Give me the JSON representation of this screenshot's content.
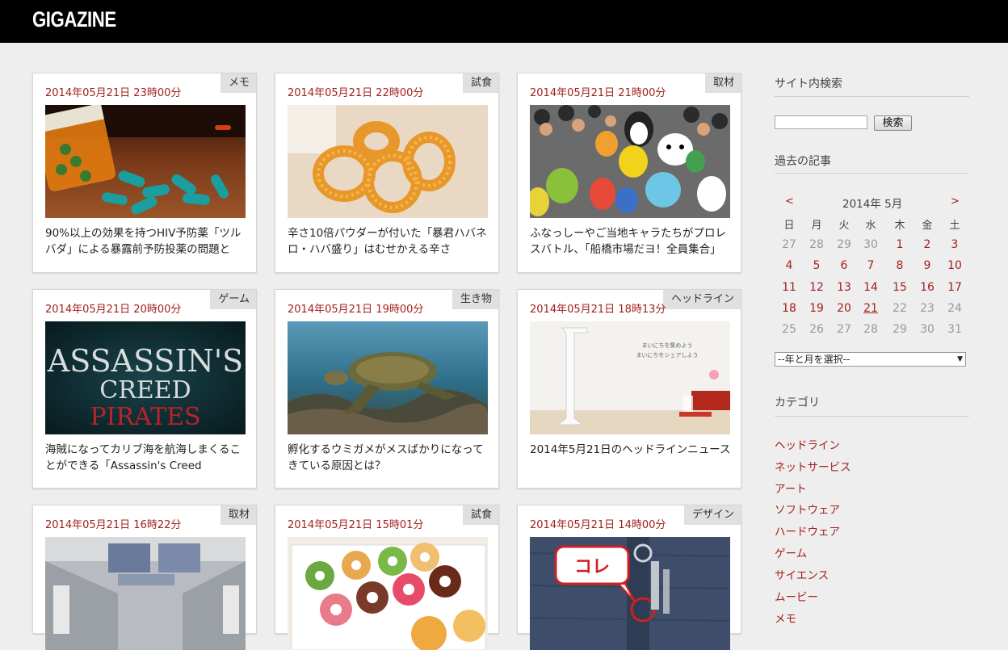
{
  "site": {
    "logo": "GIGAZINE"
  },
  "articles": [
    {
      "date": "2014年05月21日 23時00分",
      "tag": "メモ",
      "title": "90%以上の効果を持つHIV予防薬「ツルバダ」による暴露前予防投薬の問題と"
    },
    {
      "date": "2014年05月21日 22時00分",
      "tag": "試食",
      "title": "辛さ10倍パウダーが付いた「暴君ハバネロ・ハバ盛り」はむせかえる辛さ"
    },
    {
      "date": "2014年05月21日 21時00分",
      "tag": "取材",
      "title": "ふなっしーやご当地キャラたちがプロレスバトル、「船橋市場だヨ！全員集合」全試"
    },
    {
      "date": "2014年05月21日 20時00分",
      "tag": "ゲーム",
      "title": "海賊になってカリブ海を航海しまくることができる「Assassin's Creed Pirates」がブラ"
    },
    {
      "date": "2014年05月21日 19時00分",
      "tag": "生き物",
      "title": "孵化するウミガメがメスばかりになってきている原因とは？"
    },
    {
      "date": "2014年05月21日 18時13分",
      "tag": "ヘッドライン",
      "title": "2014年5月21日のヘッドラインニュース"
    },
    {
      "date": "2014年05月21日 16時22分",
      "tag": "取材",
      "title": ""
    },
    {
      "date": "2014年05月21日 15時01分",
      "tag": "試食",
      "title": ""
    },
    {
      "date": "2014年05月21日 14時00分",
      "tag": "デザイン",
      "title": ""
    }
  ],
  "thumb_text": {
    "assassins_line1": "ASSASSIN'S",
    "assassins_line2": "CREED",
    "assassins_line3": "PIRATES",
    "headline_line1": "まいにちを集めよう",
    "headline_line2": "まいにちをシェアしよう",
    "key_callout": "コレ"
  },
  "sidebar": {
    "search_heading": "サイト内検索",
    "search_button": "検索",
    "search_value": "",
    "archive_heading": "過去の記事",
    "calendar": {
      "prev": "<",
      "next": ">",
      "month_label": "2014年 5月",
      "weekdays": [
        "日",
        "月",
        "火",
        "水",
        "木",
        "金",
        "土"
      ],
      "weeks": [
        [
          "27",
          "28",
          "29",
          "30",
          "1",
          "2",
          "3"
        ],
        [
          "4",
          "5",
          "6",
          "7",
          "8",
          "9",
          "10"
        ],
        [
          "11",
          "12",
          "13",
          "14",
          "15",
          "16",
          "17"
        ],
        [
          "18",
          "19",
          "20",
          "21",
          "22",
          "23",
          "24"
        ],
        [
          "25",
          "26",
          "27",
          "28",
          "29",
          "30",
          "31"
        ]
      ]
    },
    "month_select": "--年と月を選択--",
    "category_heading": "カテゴリ",
    "categories": [
      "ヘッドライン",
      "ネットサービス",
      "アート",
      "ソフトウェア",
      "ハードウェア",
      "ゲーム",
      "サイエンス",
      "ムービー",
      "メモ"
    ]
  },
  "colors": {
    "accent": "#a3201d",
    "header": "#000000",
    "background": "#eeeeee"
  }
}
